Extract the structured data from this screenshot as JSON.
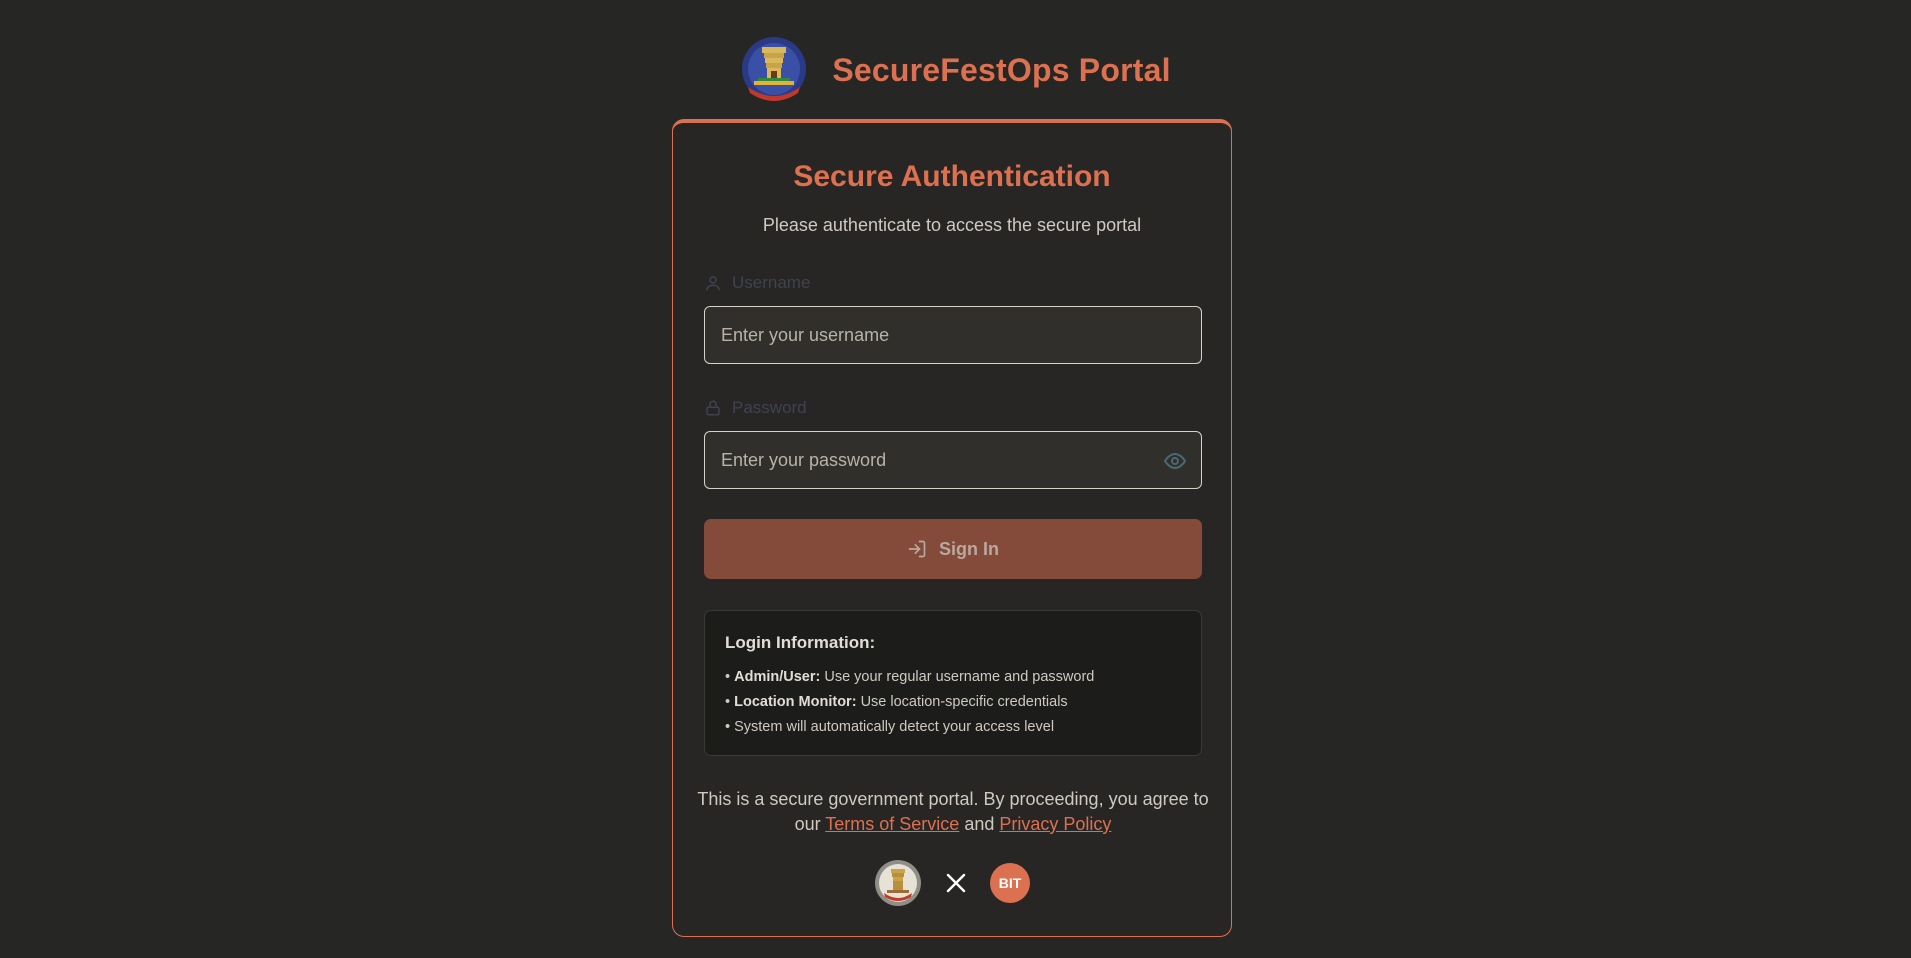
{
  "header": {
    "title": "SecureFestOps Portal",
    "logo_icon": "tamil-nadu-emblem-icon"
  },
  "card": {
    "title": "Secure Authentication",
    "subtitle": "Please authenticate to access the secure portal",
    "username": {
      "label": "Username",
      "placeholder": "Enter your username",
      "value": "",
      "icon": "user-icon"
    },
    "password": {
      "label": "Password",
      "placeholder": "Enter your password",
      "value": "",
      "icon": "lock-icon",
      "toggle_icon": "eye-icon"
    },
    "signin": {
      "label": "Sign In",
      "icon": "sign-in-icon"
    },
    "info": {
      "title": "Login Information:",
      "items": [
        {
          "bold": "Admin/User:",
          "text": "Use your regular username and password"
        },
        {
          "bold": "Location Monitor:",
          "text": "Use location-specific credentials"
        },
        {
          "bold": "",
          "text": "System will automatically detect your access level"
        }
      ]
    },
    "disclaimer": {
      "text_before": "This is a secure government portal. By proceeding, you agree to our",
      "terms": "Terms of Service",
      "and": "and",
      "privacy": "Privacy Policy"
    },
    "partners": {
      "separator": "×",
      "bit_label": "BIT"
    }
  },
  "colors": {
    "accent": "#dc7151",
    "background": "#262624",
    "button": "#844b3a"
  }
}
